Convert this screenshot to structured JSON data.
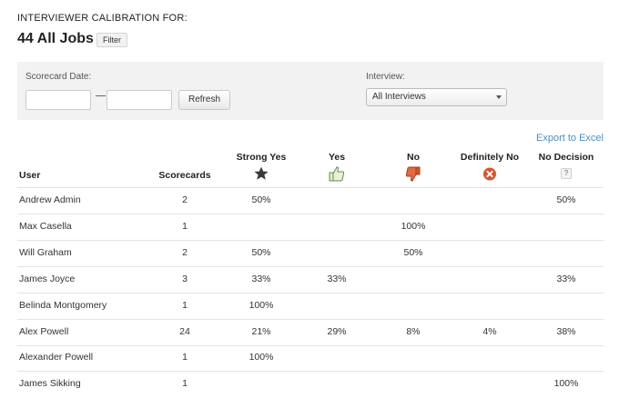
{
  "header": {
    "label": "INTERVIEWER CALIBRATION FOR:",
    "title": "44 All Jobs",
    "filter_label": "Filter"
  },
  "filters": {
    "date_label": "Scorecard Date:",
    "refresh_label": "Refresh",
    "interview_label": "Interview:",
    "interview_selected": "All Interviews"
  },
  "export_label": "Export to Excel",
  "columns": {
    "user": "User",
    "scorecards": "Scorecards",
    "strong_yes": "Strong Yes",
    "yes": "Yes",
    "no": "No",
    "definitely_no": "Definitely No",
    "no_decision": "No Decision",
    "no_decision_icon": "?"
  },
  "icons": {
    "strong_yes": "star-icon",
    "yes": "thumbs-up-icon",
    "no": "thumbs-down-icon",
    "definitely_no": "x-circle-icon",
    "no_decision": "question-icon"
  },
  "colors": {
    "link": "#4a8ec2",
    "no_red": "#d9532c",
    "panel": "#f2f2f2"
  },
  "rows": [
    {
      "user": "Andrew Admin",
      "scorecards": "2",
      "strong_yes": "50%",
      "yes": "",
      "no": "",
      "definitely_no": "",
      "no_decision": "50%"
    },
    {
      "user": "Max Casella",
      "scorecards": "1",
      "strong_yes": "",
      "yes": "",
      "no": "100%",
      "definitely_no": "",
      "no_decision": ""
    },
    {
      "user": "Will Graham",
      "scorecards": "2",
      "strong_yes": "50%",
      "yes": "",
      "no": "50%",
      "definitely_no": "",
      "no_decision": ""
    },
    {
      "user": "James Joyce",
      "scorecards": "3",
      "strong_yes": "33%",
      "yes": "33%",
      "no": "",
      "definitely_no": "",
      "no_decision": "33%"
    },
    {
      "user": "Belinda Montgomery",
      "scorecards": "1",
      "strong_yes": "100%",
      "yes": "",
      "no": "",
      "definitely_no": "",
      "no_decision": ""
    },
    {
      "user": "Alex Powell",
      "scorecards": "24",
      "strong_yes": "21%",
      "yes": "29%",
      "no": "8%",
      "definitely_no": "4%",
      "no_decision": "38%"
    },
    {
      "user": "Alexander Powell",
      "scorecards": "1",
      "strong_yes": "100%",
      "yes": "",
      "no": "",
      "definitely_no": "",
      "no_decision": ""
    },
    {
      "user": "James Sikking",
      "scorecards": "1",
      "strong_yes": "",
      "yes": "",
      "no": "",
      "definitely_no": "",
      "no_decision": "100%"
    }
  ]
}
